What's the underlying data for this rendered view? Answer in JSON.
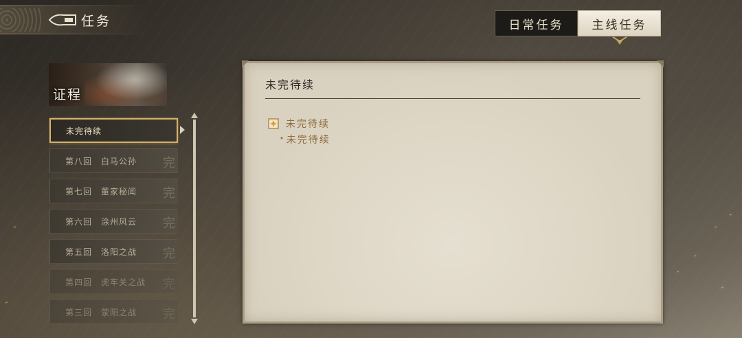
{
  "header": {
    "title": "任务"
  },
  "tabs": [
    {
      "label": "日常任务",
      "active": false
    },
    {
      "label": "主线任务",
      "active": true
    }
  ],
  "banner": {
    "title": "证程"
  },
  "chapters": [
    {
      "label": "未完待续",
      "selected": true
    },
    {
      "label": "第八回　白马公孙",
      "done_mark": "完"
    },
    {
      "label": "第七回　董家秘闻",
      "done_mark": "完"
    },
    {
      "label": "第六回　涂州风云",
      "done_mark": "完"
    },
    {
      "label": "第五回　洛阳之战",
      "done_mark": "完"
    },
    {
      "label": "第四回　虎牢关之战",
      "done_mark": "完"
    },
    {
      "label": "第三回　荥阳之战",
      "done_mark": "完"
    }
  ],
  "quest": {
    "heading": "未完待续",
    "objective": "未完待续",
    "sub_objective": "未完待续",
    "sub_bullet": "•"
  },
  "colors": {
    "accent_gold": "#d4b26a",
    "objective_text": "#8b6a3c"
  }
}
